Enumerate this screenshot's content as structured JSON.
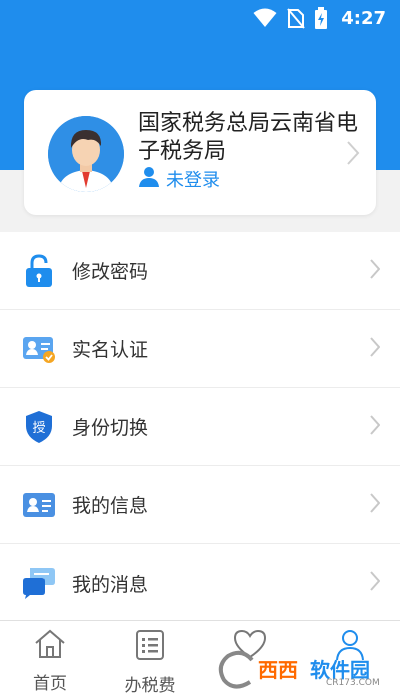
{
  "status_bar": {
    "time": "4:27",
    "icons": [
      "wifi-icon",
      "no-sim-icon",
      "battery-charging-icon"
    ]
  },
  "profile": {
    "title": "国家税务总局云南省电子税务局",
    "login_status": "未登录",
    "avatar_icon": "user-avatar-icon",
    "accent": "#1f8ded"
  },
  "menu": {
    "items": [
      {
        "label": "修改密码",
        "icon": "lock-icon"
      },
      {
        "label": "实名认证",
        "icon": "id-verify-icon"
      },
      {
        "label": "身份切换",
        "icon": "shield-auth-icon"
      },
      {
        "label": "我的信息",
        "icon": "id-card-icon"
      },
      {
        "label": "我的消息",
        "icon": "message-icon"
      }
    ]
  },
  "tabbar": {
    "tabs": [
      {
        "label": "首页",
        "icon": "home-icon"
      },
      {
        "label": "办税费",
        "icon": "list-icon"
      },
      {
        "label": "",
        "icon": "heart-icon"
      },
      {
        "label": "",
        "icon": "user-icon"
      }
    ]
  },
  "watermark": {
    "text_a": "西西",
    "text_b": "软件园",
    "sub": "CR173.COM"
  }
}
